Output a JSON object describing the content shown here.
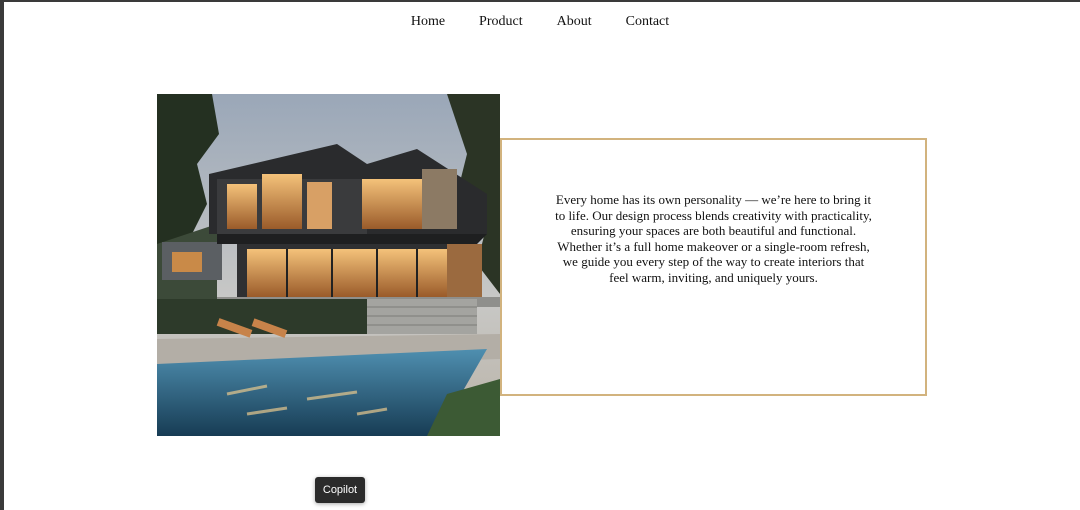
{
  "nav": {
    "items": [
      {
        "label": "Home"
      },
      {
        "label": "Product"
      },
      {
        "label": "About"
      },
      {
        "label": "Contact"
      }
    ]
  },
  "hero": {
    "image": {
      "subject": "modern-house-with-pool"
    },
    "text": "Every home has its own personality — we’re here to bring it to life. Our design process blends creativity with practicality, ensuring your spaces are both beautiful and functional. Whether it’s a full home makeover or a single-room refresh, we guide you every step of the way to create interiors that feel warm, inviting, and uniquely yours.",
    "border_color": "#d2b37e"
  },
  "copilot": {
    "label": "Copilot"
  }
}
